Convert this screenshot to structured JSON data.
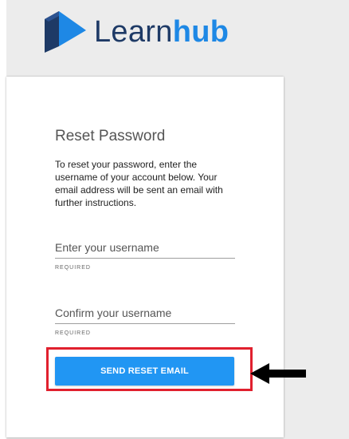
{
  "brand": {
    "name_light": "Learn",
    "name_bold": "hub",
    "logo_icon": "learnhub-cube-icon",
    "colors": {
      "dark": "#1e3a66",
      "accent": "#1e88e5"
    }
  },
  "form": {
    "title": "Reset Password",
    "description": "To reset your password, enter the username of your account below. Your email address will be sent an email with further instructions.",
    "username": {
      "placeholder": "Enter your username",
      "value": "",
      "hint": "REQUIRED"
    },
    "confirm_username": {
      "placeholder": "Confirm your username",
      "value": "",
      "hint": "REQUIRED"
    },
    "submit_label": "SEND RESET EMAIL",
    "button_color": "#2196f3"
  },
  "annotations": {
    "highlight_color": "#e0202e",
    "arrow_icon": "left-arrow-icon"
  }
}
